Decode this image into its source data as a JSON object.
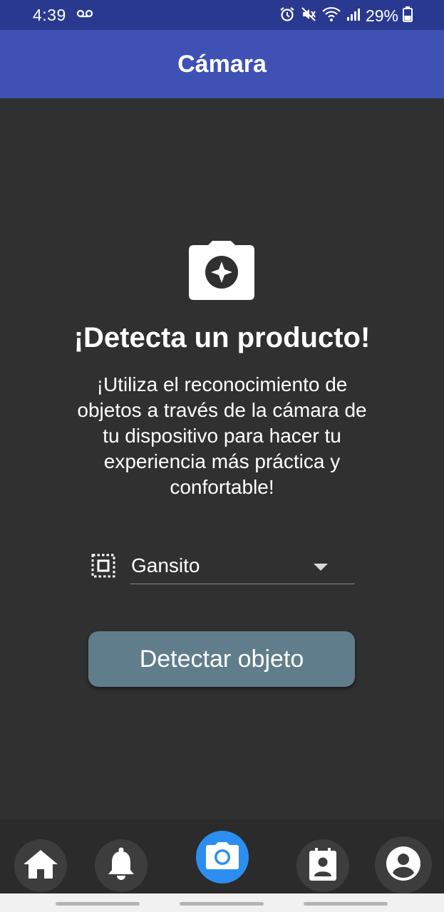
{
  "status_bar": {
    "time": "4:39",
    "battery_percent": "29%",
    "icons": [
      "voicemail-icon",
      "alarm-icon",
      "mute-icon",
      "wifi-icon",
      "signal-icon",
      "battery-icon"
    ]
  },
  "app_bar": {
    "title": "Cámara"
  },
  "hero": {
    "icon": "camera-icon",
    "headline": "¡Detecta un producto!",
    "description": "¡Utiliza el reconocimiento de objetos a través de la cámara de tu dispositivo para hacer tu experiencia más práctica y confortable!"
  },
  "object_select": {
    "icon": "object-select-icon",
    "value": "Gansito"
  },
  "detect_button": {
    "label": "Detectar objeto"
  },
  "bottom_nav": {
    "items": [
      {
        "icon": "home-icon",
        "active": false
      },
      {
        "icon": "bell-icon",
        "active": false
      },
      {
        "icon": "camera-icon",
        "active": true
      },
      {
        "icon": "contacts-icon",
        "active": false
      },
      {
        "icon": "profile-icon",
        "active": false
      }
    ],
    "active_color": "#2d8ef2"
  },
  "colors": {
    "primary": "#3f51b5",
    "status_bar": "#2a3990",
    "background": "#303030",
    "button": "#607d8b"
  }
}
